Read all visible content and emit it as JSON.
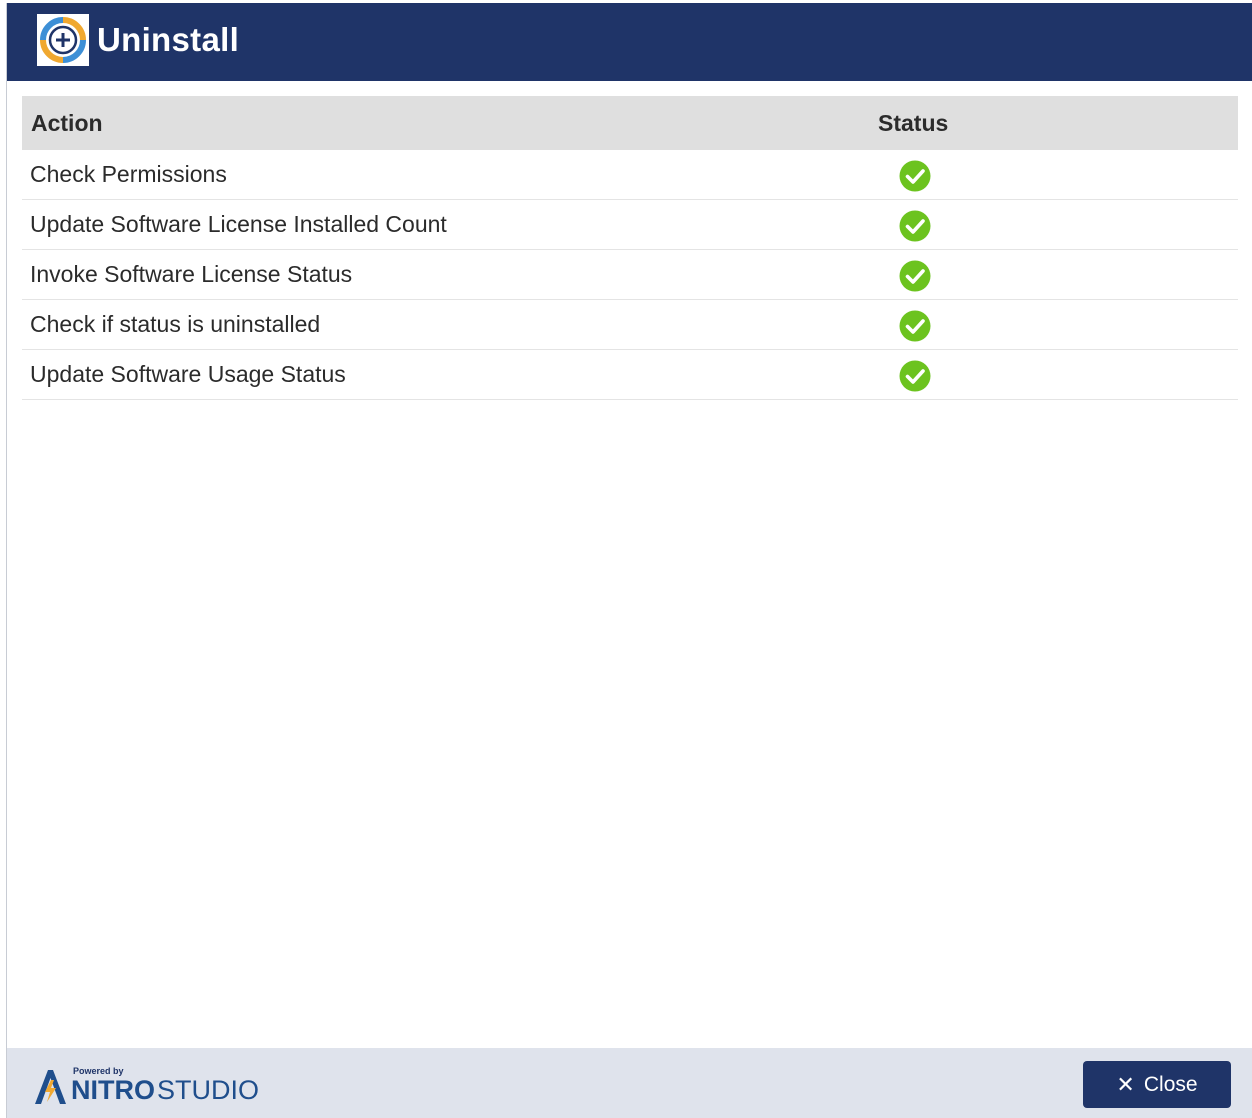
{
  "window": {
    "title": "Uninstall",
    "icon": "uninstall-app-icon"
  },
  "table": {
    "columns": {
      "action": "Action",
      "status": "Status"
    },
    "rows": [
      {
        "action": "Check Permissions",
        "status": "success-check-icon"
      },
      {
        "action": "Update Software License Installed Count",
        "status": "success-check-icon"
      },
      {
        "action": "Invoke Software License Status",
        "status": "success-check-icon"
      },
      {
        "action": "Check if status is uninstalled",
        "status": "success-check-icon"
      },
      {
        "action": "Update Software Usage Status",
        "status": "success-check-icon"
      }
    ]
  },
  "footer": {
    "powered_by": "Powered by",
    "brand_bold": "NITRO",
    "brand_regular": "STUDIO",
    "close_label": "Close",
    "close_icon": "close-icon"
  },
  "colors": {
    "titlebar": "#1f3468",
    "header_row": "#dfdfdf",
    "footer": "#dfe3ec",
    "success": "#6cc31f",
    "button": "#1f3468"
  }
}
